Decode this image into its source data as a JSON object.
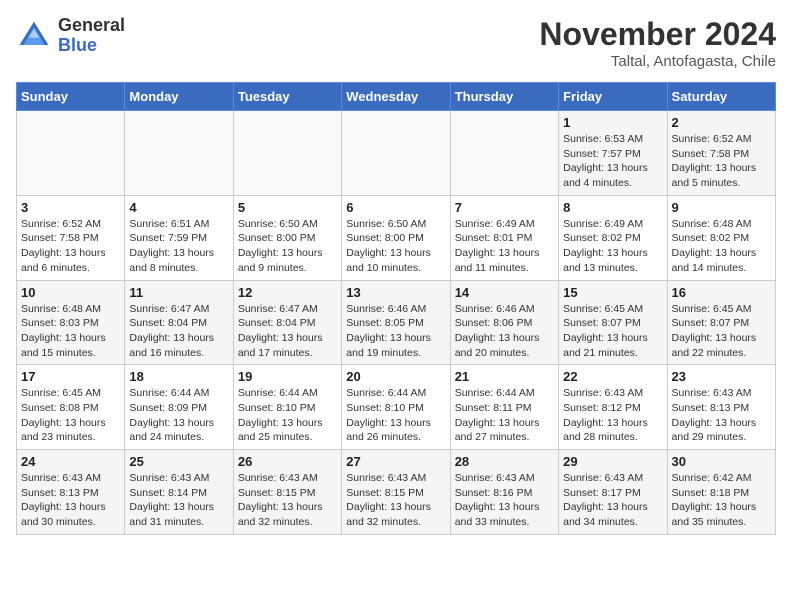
{
  "logo": {
    "line1": "General",
    "line2": "Blue"
  },
  "title": "November 2024",
  "location": "Taltal, Antofagasta, Chile",
  "weekdays": [
    "Sunday",
    "Monday",
    "Tuesday",
    "Wednesday",
    "Thursday",
    "Friday",
    "Saturday"
  ],
  "rows": [
    [
      {
        "day": "",
        "info": ""
      },
      {
        "day": "",
        "info": ""
      },
      {
        "day": "",
        "info": ""
      },
      {
        "day": "",
        "info": ""
      },
      {
        "day": "",
        "info": ""
      },
      {
        "day": "1",
        "info": "Sunrise: 6:53 AM\nSunset: 7:57 PM\nDaylight: 13 hours and 4 minutes."
      },
      {
        "day": "2",
        "info": "Sunrise: 6:52 AM\nSunset: 7:58 PM\nDaylight: 13 hours and 5 minutes."
      }
    ],
    [
      {
        "day": "3",
        "info": "Sunrise: 6:52 AM\nSunset: 7:58 PM\nDaylight: 13 hours and 6 minutes."
      },
      {
        "day": "4",
        "info": "Sunrise: 6:51 AM\nSunset: 7:59 PM\nDaylight: 13 hours and 8 minutes."
      },
      {
        "day": "5",
        "info": "Sunrise: 6:50 AM\nSunset: 8:00 PM\nDaylight: 13 hours and 9 minutes."
      },
      {
        "day": "6",
        "info": "Sunrise: 6:50 AM\nSunset: 8:00 PM\nDaylight: 13 hours and 10 minutes."
      },
      {
        "day": "7",
        "info": "Sunrise: 6:49 AM\nSunset: 8:01 PM\nDaylight: 13 hours and 11 minutes."
      },
      {
        "day": "8",
        "info": "Sunrise: 6:49 AM\nSunset: 8:02 PM\nDaylight: 13 hours and 13 minutes."
      },
      {
        "day": "9",
        "info": "Sunrise: 6:48 AM\nSunset: 8:02 PM\nDaylight: 13 hours and 14 minutes."
      }
    ],
    [
      {
        "day": "10",
        "info": "Sunrise: 6:48 AM\nSunset: 8:03 PM\nDaylight: 13 hours and 15 minutes."
      },
      {
        "day": "11",
        "info": "Sunrise: 6:47 AM\nSunset: 8:04 PM\nDaylight: 13 hours and 16 minutes."
      },
      {
        "day": "12",
        "info": "Sunrise: 6:47 AM\nSunset: 8:04 PM\nDaylight: 13 hours and 17 minutes."
      },
      {
        "day": "13",
        "info": "Sunrise: 6:46 AM\nSunset: 8:05 PM\nDaylight: 13 hours and 19 minutes."
      },
      {
        "day": "14",
        "info": "Sunrise: 6:46 AM\nSunset: 8:06 PM\nDaylight: 13 hours and 20 minutes."
      },
      {
        "day": "15",
        "info": "Sunrise: 6:45 AM\nSunset: 8:07 PM\nDaylight: 13 hours and 21 minutes."
      },
      {
        "day": "16",
        "info": "Sunrise: 6:45 AM\nSunset: 8:07 PM\nDaylight: 13 hours and 22 minutes."
      }
    ],
    [
      {
        "day": "17",
        "info": "Sunrise: 6:45 AM\nSunset: 8:08 PM\nDaylight: 13 hours and 23 minutes."
      },
      {
        "day": "18",
        "info": "Sunrise: 6:44 AM\nSunset: 8:09 PM\nDaylight: 13 hours and 24 minutes."
      },
      {
        "day": "19",
        "info": "Sunrise: 6:44 AM\nSunset: 8:10 PM\nDaylight: 13 hours and 25 minutes."
      },
      {
        "day": "20",
        "info": "Sunrise: 6:44 AM\nSunset: 8:10 PM\nDaylight: 13 hours and 26 minutes."
      },
      {
        "day": "21",
        "info": "Sunrise: 6:44 AM\nSunset: 8:11 PM\nDaylight: 13 hours and 27 minutes."
      },
      {
        "day": "22",
        "info": "Sunrise: 6:43 AM\nSunset: 8:12 PM\nDaylight: 13 hours and 28 minutes."
      },
      {
        "day": "23",
        "info": "Sunrise: 6:43 AM\nSunset: 8:13 PM\nDaylight: 13 hours and 29 minutes."
      }
    ],
    [
      {
        "day": "24",
        "info": "Sunrise: 6:43 AM\nSunset: 8:13 PM\nDaylight: 13 hours and 30 minutes."
      },
      {
        "day": "25",
        "info": "Sunrise: 6:43 AM\nSunset: 8:14 PM\nDaylight: 13 hours and 31 minutes."
      },
      {
        "day": "26",
        "info": "Sunrise: 6:43 AM\nSunset: 8:15 PM\nDaylight: 13 hours and 32 minutes."
      },
      {
        "day": "27",
        "info": "Sunrise: 6:43 AM\nSunset: 8:15 PM\nDaylight: 13 hours and 32 minutes."
      },
      {
        "day": "28",
        "info": "Sunrise: 6:43 AM\nSunset: 8:16 PM\nDaylight: 13 hours and 33 minutes."
      },
      {
        "day": "29",
        "info": "Sunrise: 6:43 AM\nSunset: 8:17 PM\nDaylight: 13 hours and 34 minutes."
      },
      {
        "day": "30",
        "info": "Sunrise: 6:42 AM\nSunset: 8:18 PM\nDaylight: 13 hours and 35 minutes."
      }
    ]
  ]
}
